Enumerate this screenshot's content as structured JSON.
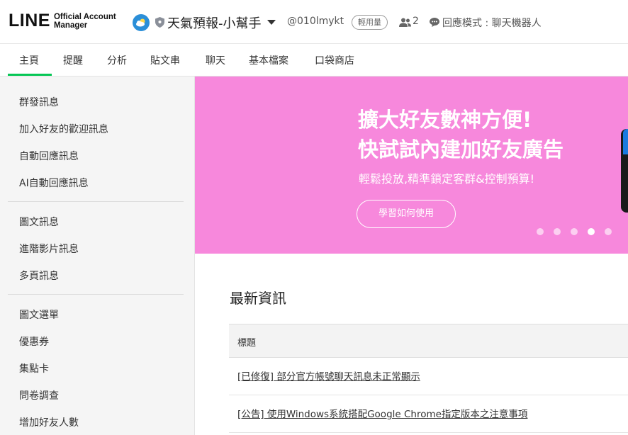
{
  "header": {
    "logo_main": "LINE",
    "logo_sub_1": "Official Account",
    "logo_sub_2": "Manager",
    "account_name": "天氣預報-小幫手",
    "account_id": "@010lmykt",
    "plan_badge": "輕用量",
    "members_count": "2",
    "mode_text": "回應模式 : 聊天機器人"
  },
  "tabs": [
    {
      "label": "主頁"
    },
    {
      "label": "提醒"
    },
    {
      "label": "分析"
    },
    {
      "label": "貼文串"
    },
    {
      "label": "聊天"
    },
    {
      "label": "基本檔案"
    },
    {
      "label": "口袋商店"
    }
  ],
  "sidebar": {
    "groups": [
      [
        "群發訊息",
        "加入好友的歡迎訊息",
        "自動回應訊息",
        "AI自動回應訊息"
      ],
      [
        "圖文訊息",
        "進階影片訊息",
        "多頁訊息"
      ],
      [
        "圖文選單",
        "優惠券",
        "集點卡",
        "問卷調查",
        "增加好友人數"
      ]
    ]
  },
  "banner": {
    "title_line1": "擴大好友數神方便!",
    "title_line2": "快試試內建加好友廣告",
    "subtitle": "輕鬆投放,精準鎖定客群&控制預算!",
    "button": "學習如何使用",
    "dots_count": 5,
    "active_dot": 4
  },
  "news": {
    "title": "最新資訊",
    "column_header": "標題",
    "rows": [
      "[已修復] 部分官方帳號聊天訊息未正常顯示",
      "[公告] 使用Windows系統搭配Google Chrome指定版本之注意事項"
    ]
  },
  "colors": {
    "accent": "#06c755",
    "banner_bg": "#f788dc",
    "avatar_bg": "#2b8fd8"
  }
}
